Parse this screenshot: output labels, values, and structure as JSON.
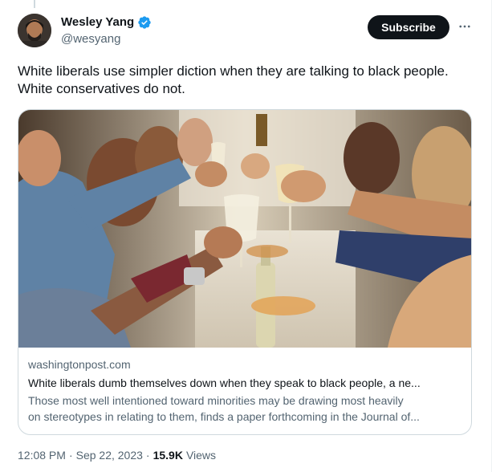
{
  "author": {
    "display_name": "Wesley Yang",
    "handle": "@wesyang",
    "verified": true
  },
  "actions": {
    "subscribe_label": "Subscribe",
    "more_icon": "more-horizontal-icon"
  },
  "tweet": {
    "text_line1": "White liberals use simpler diction when they are talking to black people.",
    "text_line2": "White conservatives do not."
  },
  "card": {
    "domain": "washingtonpost.com",
    "title": "White liberals dumb themselves down when they speak to black people, a ne...",
    "description_line1": "Those most well intentioned toward minorities may be drawing most heavily",
    "description_line2": "on stereotypes in relating to them, finds a paper forthcoming in the Journal of..."
  },
  "meta": {
    "time": "12:08 PM",
    "separator": "·",
    "date": "Sep 22, 2023",
    "views_count": "15.9K",
    "views_label": "Views"
  },
  "colors": {
    "text_primary": "#0f1419",
    "text_secondary": "#536471",
    "verified_blue": "#1d9bf0",
    "border": "#cfd9de"
  }
}
